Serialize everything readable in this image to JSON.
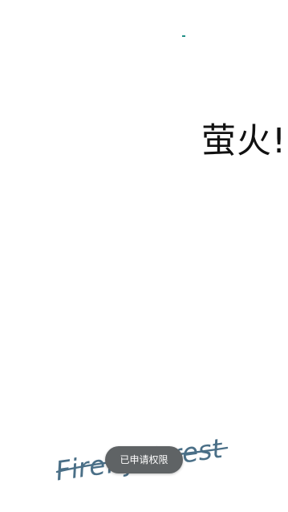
{
  "app": {
    "title_visible": "萤火!",
    "brand_text": "Firefly forest"
  },
  "toast": {
    "message": "已申请权限"
  },
  "icons": {
    "accent_dot": "progress-dot-icon"
  },
  "colors": {
    "accent": "#1f8f86",
    "brand_ink": "#4a6f87",
    "toast_bg": "#5f6365",
    "toast_text": "#ffffff"
  }
}
